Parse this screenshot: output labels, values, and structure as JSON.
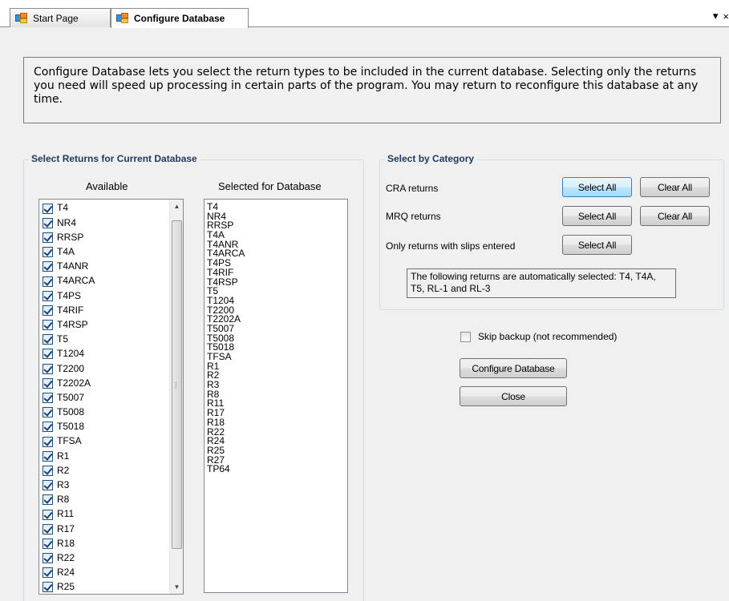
{
  "tabs": [
    {
      "label": "Start Page",
      "active": false
    },
    {
      "label": "Configure Database",
      "active": true
    }
  ],
  "tab_controls": {
    "dropdown": "▾",
    "close": "×"
  },
  "info_text": "Configure Database lets you select the return types to be included in the current database. Selecting only the returns you need will speed up processing in certain parts of the program. You may return to reconfigure this database at any time.",
  "returns_group": {
    "title": "Select Returns for Current Database",
    "available_label": "Available",
    "selected_label": "Selected for Database",
    "available": [
      "T4",
      "NR4",
      "RRSP",
      "T4A",
      "T4ANR",
      "T4ARCA",
      "T4PS",
      "T4RIF",
      "T4RSP",
      "T5",
      "T1204",
      "T2200",
      "T2202A",
      "T5007",
      "T5008",
      "T5018",
      "TFSA",
      "R1",
      "R2",
      "R3",
      "R8",
      "R11",
      "R17",
      "R18",
      "R22",
      "R24",
      "R25"
    ],
    "selected": [
      "T4",
      "NR4",
      "RRSP",
      "T4A",
      "T4ANR",
      "T4ARCA",
      "T4PS",
      "T4RIF",
      "T4RSP",
      "T5",
      "T1204",
      "T2200",
      "T2202A",
      "T5007",
      "T5008",
      "T5018",
      "TFSA",
      "R1",
      "R2",
      "R3",
      "R8",
      "R11",
      "R17",
      "R18",
      "R22",
      "R24",
      "R25",
      "R27",
      "TP64"
    ]
  },
  "category_group": {
    "title": "Select by Category",
    "cra_label": "CRA returns",
    "mrq_label": "MRQ returns",
    "slips_label": "Only returns with slips entered",
    "select_all": "Select All",
    "clear_all": "Clear All",
    "note": "The following returns are automatically selected: T4, T4A, T5, RL-1 and RL-3"
  },
  "skip_backup_label": "Skip backup (not recommended)",
  "configure_button": "Configure Database",
  "close_button": "Close"
}
